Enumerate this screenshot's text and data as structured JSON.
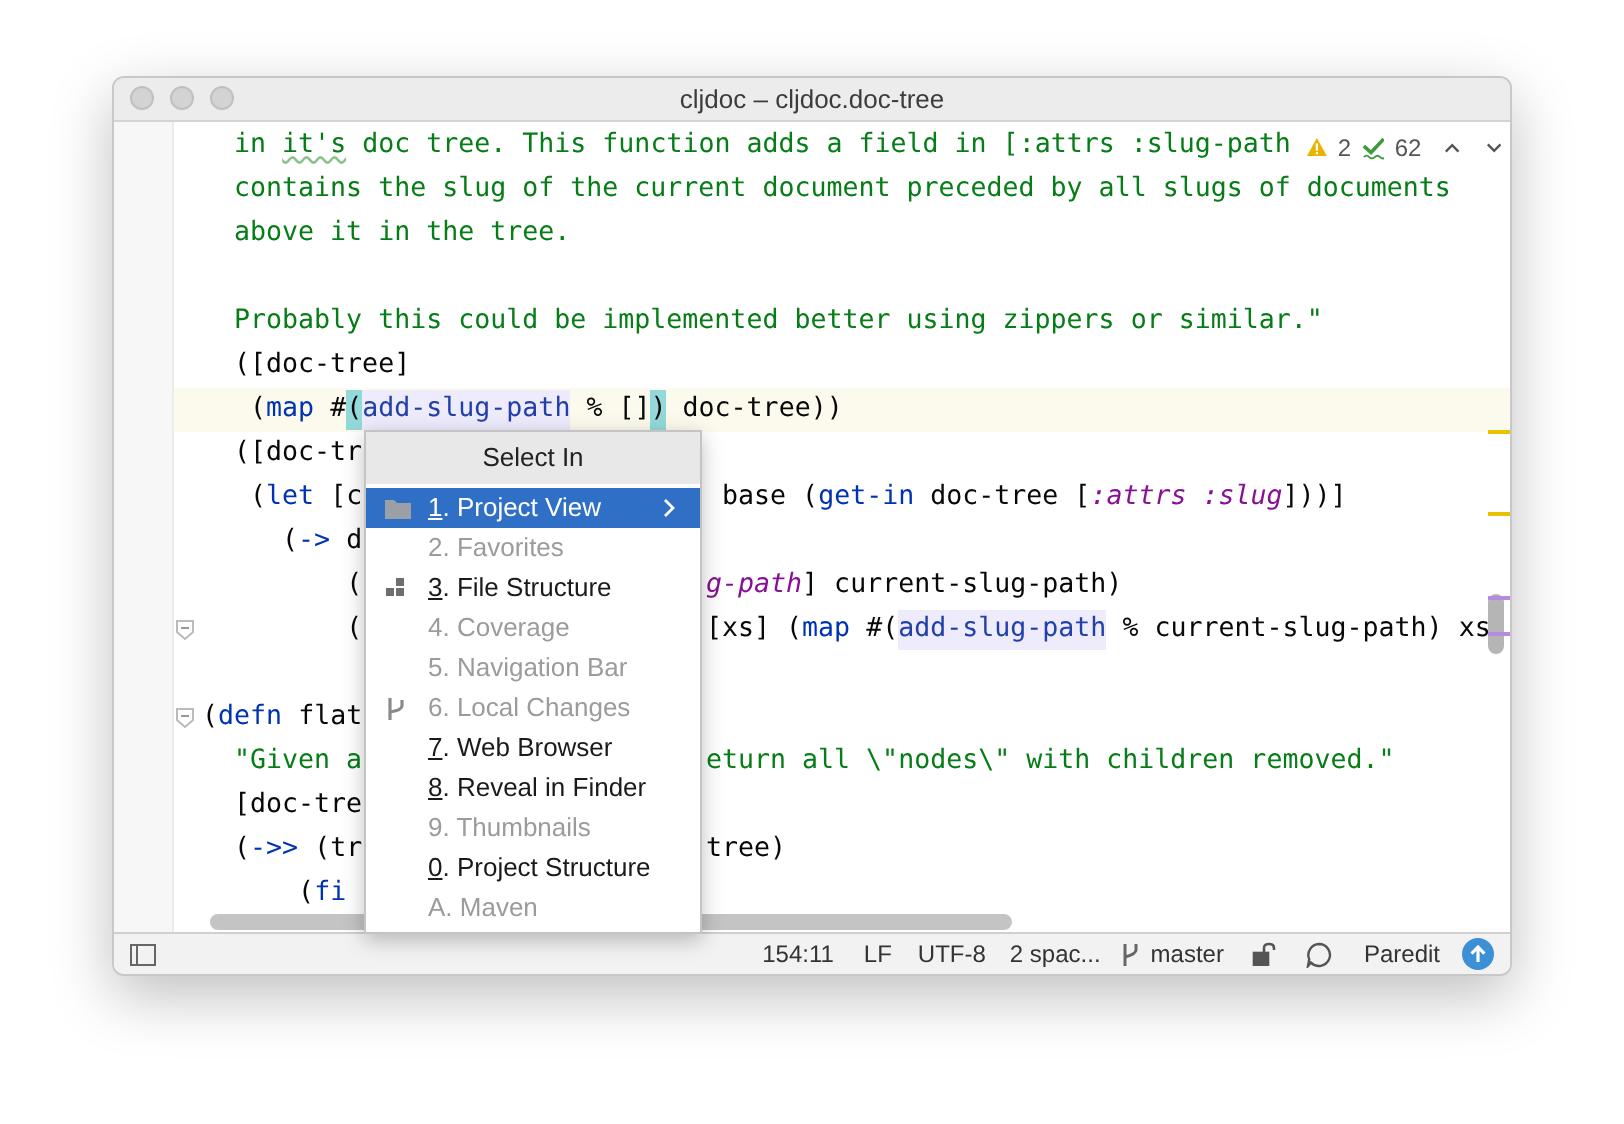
{
  "window": {
    "title": "cljdoc – cljdoc.doc-tree"
  },
  "inspections": {
    "warnings": "2",
    "weak_warnings": "62"
  },
  "code_lines": [
    {
      "current": false,
      "fold": false,
      "segments": [
        {
          "tokens": [
            {
              "kind": "string",
              "text": "  in "
            },
            {
              "kind": "typo",
              "text": "it's"
            },
            {
              "kind": "string",
              "text": " doc tree. This function adds a field in [:attrs :slug-path"
            }
          ]
        }
      ]
    },
    {
      "current": false,
      "fold": false,
      "segments": [
        {
          "tokens": [
            {
              "kind": "string",
              "text": "  contains the slug of the current document preceded by all slugs of documents"
            }
          ]
        }
      ]
    },
    {
      "current": false,
      "fold": false,
      "segments": [
        {
          "tokens": [
            {
              "kind": "string",
              "text": "  above it in the tree."
            }
          ]
        }
      ]
    },
    {
      "current": false,
      "fold": false
    },
    {
      "current": false,
      "fold": false,
      "segments": [
        {
          "tokens": [
            {
              "kind": "string",
              "text": "  Probably this could be implemented better using zippers or similar.\""
            }
          ]
        }
      ]
    },
    {
      "current": false,
      "fold": false,
      "segments": [
        {
          "tokens": [
            {
              "kind": "plain",
              "text": "  ([doc-tree]"
            }
          ]
        }
      ]
    },
    {
      "current": true,
      "fold": false,
      "segments": [
        {
          "tokens": [
            {
              "kind": "plain",
              "text": "   ("
            },
            {
              "kind": "call",
              "text": "map"
            },
            {
              "kind": "plain",
              "text": " #"
            },
            {
              "kind": "brace",
              "text": "("
            },
            {
              "kind": "ref",
              "text": "add-slug-path"
            },
            {
              "kind": "plain",
              "text": " % []"
            },
            {
              "kind": "brace",
              "text": ")"
            },
            {
              "kind": "plain",
              "text": " doc-tree))"
            }
          ]
        }
      ]
    },
    {
      "current": false,
      "fold": false,
      "segments": [
        {
          "tokens": [
            {
              "kind": "plain",
              "text": "  ([doc-tr"
            }
          ]
        }
      ]
    },
    {
      "current": false,
      "fold": false,
      "segments": [
        {
          "tokens": [
            {
              "kind": "plain",
              "text": "   ("
            },
            {
              "kind": "call",
              "text": "let"
            },
            {
              "kind": "plain",
              "text": " [c"
            }
          ]
        },
        {
          "tokens": [
            {
              "kind": "plain",
              "text": " base ("
            },
            {
              "kind": "call",
              "text": "get-in"
            },
            {
              "kind": "plain",
              "text": " doc-tree ["
            },
            {
              "kind": "keyword",
              "text": ":attrs :slug"
            },
            {
              "kind": "plain",
              "text": "]))]"
            }
          ]
        }
      ]
    },
    {
      "current": false,
      "fold": false,
      "segments": [
        {
          "tokens": [
            {
              "kind": "plain",
              "text": "     ("
            },
            {
              "kind": "call",
              "text": "->"
            },
            {
              "kind": "plain",
              "text": " d"
            }
          ]
        }
      ]
    },
    {
      "current": false,
      "fold": false,
      "segments": [
        {
          "tokens": [
            {
              "kind": "plain",
              "text": "         ("
            }
          ]
        },
        {
          "tokens": [
            {
              "kind": "keyword",
              "text": "g-path"
            },
            {
              "kind": "plain",
              "text": "] current-slug-path)"
            }
          ]
        }
      ]
    },
    {
      "current": false,
      "fold": true,
      "segments": [
        {
          "tokens": [
            {
              "kind": "plain",
              "text": "         ("
            }
          ]
        },
        {
          "tokens": [
            {
              "kind": "plain",
              "text": "[xs] ("
            },
            {
              "kind": "call",
              "text": "map"
            },
            {
              "kind": "plain",
              "text": " #("
            },
            {
              "kind": "ref",
              "text": "add-slug-path"
            },
            {
              "kind": "plain",
              "text": " % current-slug-path) xs"
            }
          ]
        }
      ]
    },
    {
      "current": false,
      "fold": false
    },
    {
      "current": false,
      "fold": true,
      "segments": [
        {
          "tokens": [
            {
              "kind": "plain",
              "text": "("
            },
            {
              "kind": "call",
              "text": "defn"
            },
            {
              "kind": "plain",
              "text": " flat"
            }
          ]
        }
      ]
    },
    {
      "current": false,
      "fold": false,
      "segments": [
        {
          "tokens": [
            {
              "kind": "string",
              "text": "  \"Given a"
            }
          ]
        },
        {
          "tokens": [
            {
              "kind": "string",
              "text": "eturn all \\\"nodes\\\" with children removed.\""
            }
          ]
        }
      ]
    },
    {
      "current": false,
      "fold": false,
      "segments": [
        {
          "tokens": [
            {
              "kind": "plain",
              "text": "  [doc-tre"
            }
          ]
        }
      ]
    },
    {
      "current": false,
      "fold": false,
      "segments": [
        {
          "tokens": [
            {
              "kind": "plain",
              "text": "  ("
            },
            {
              "kind": "call",
              "text": "->>"
            },
            {
              "kind": "plain",
              "text": " (tr"
            }
          ]
        },
        {
          "tokens": [
            {
              "kind": "plain",
              "text": "tree)"
            }
          ]
        }
      ]
    },
    {
      "current": false,
      "fold": false,
      "segments": [
        {
          "tokens": [
            {
              "kind": "plain",
              "text": "      ("
            },
            {
              "kind": "call",
              "text": "fi"
            }
          ]
        }
      ]
    }
  ],
  "popup": {
    "title": "Select In",
    "items": [
      {
        "text": "1. Project View",
        "kind": "folder",
        "selected": true,
        "disabled": false,
        "submenu": true
      },
      {
        "text": "2. Favorites",
        "kind": "plain",
        "selected": false,
        "disabled": true,
        "submenu": false
      },
      {
        "text": "3. File Structure",
        "kind": "structure",
        "selected": false,
        "disabled": false,
        "submenu": false
      },
      {
        "text": "4. Coverage",
        "kind": "plain",
        "selected": false,
        "disabled": true,
        "submenu": false
      },
      {
        "text": "5. Navigation Bar",
        "kind": "plain",
        "selected": false,
        "disabled": true,
        "submenu": false
      },
      {
        "text": "6. Local Changes",
        "kind": "branch",
        "selected": false,
        "disabled": true,
        "submenu": false
      },
      {
        "text": "7. Web Browser",
        "kind": "plain",
        "selected": false,
        "disabled": false,
        "submenu": false
      },
      {
        "text": "8. Reveal in Finder",
        "kind": "plain",
        "selected": false,
        "disabled": false,
        "submenu": false
      },
      {
        "text": "9. Thumbnails",
        "kind": "plain",
        "selected": false,
        "disabled": true,
        "submenu": false
      },
      {
        "text": "0. Project Structure",
        "kind": "plain",
        "selected": false,
        "disabled": false,
        "submenu": false
      },
      {
        "text": "A. Maven",
        "kind": "plain",
        "selected": false,
        "disabled": true,
        "submenu": false
      }
    ]
  },
  "status_bar": {
    "position": "154:11",
    "line_separator": "LF",
    "encoding": "UTF-8",
    "indent": "2 spac...",
    "branch": "master",
    "mode": "Paredit"
  }
}
